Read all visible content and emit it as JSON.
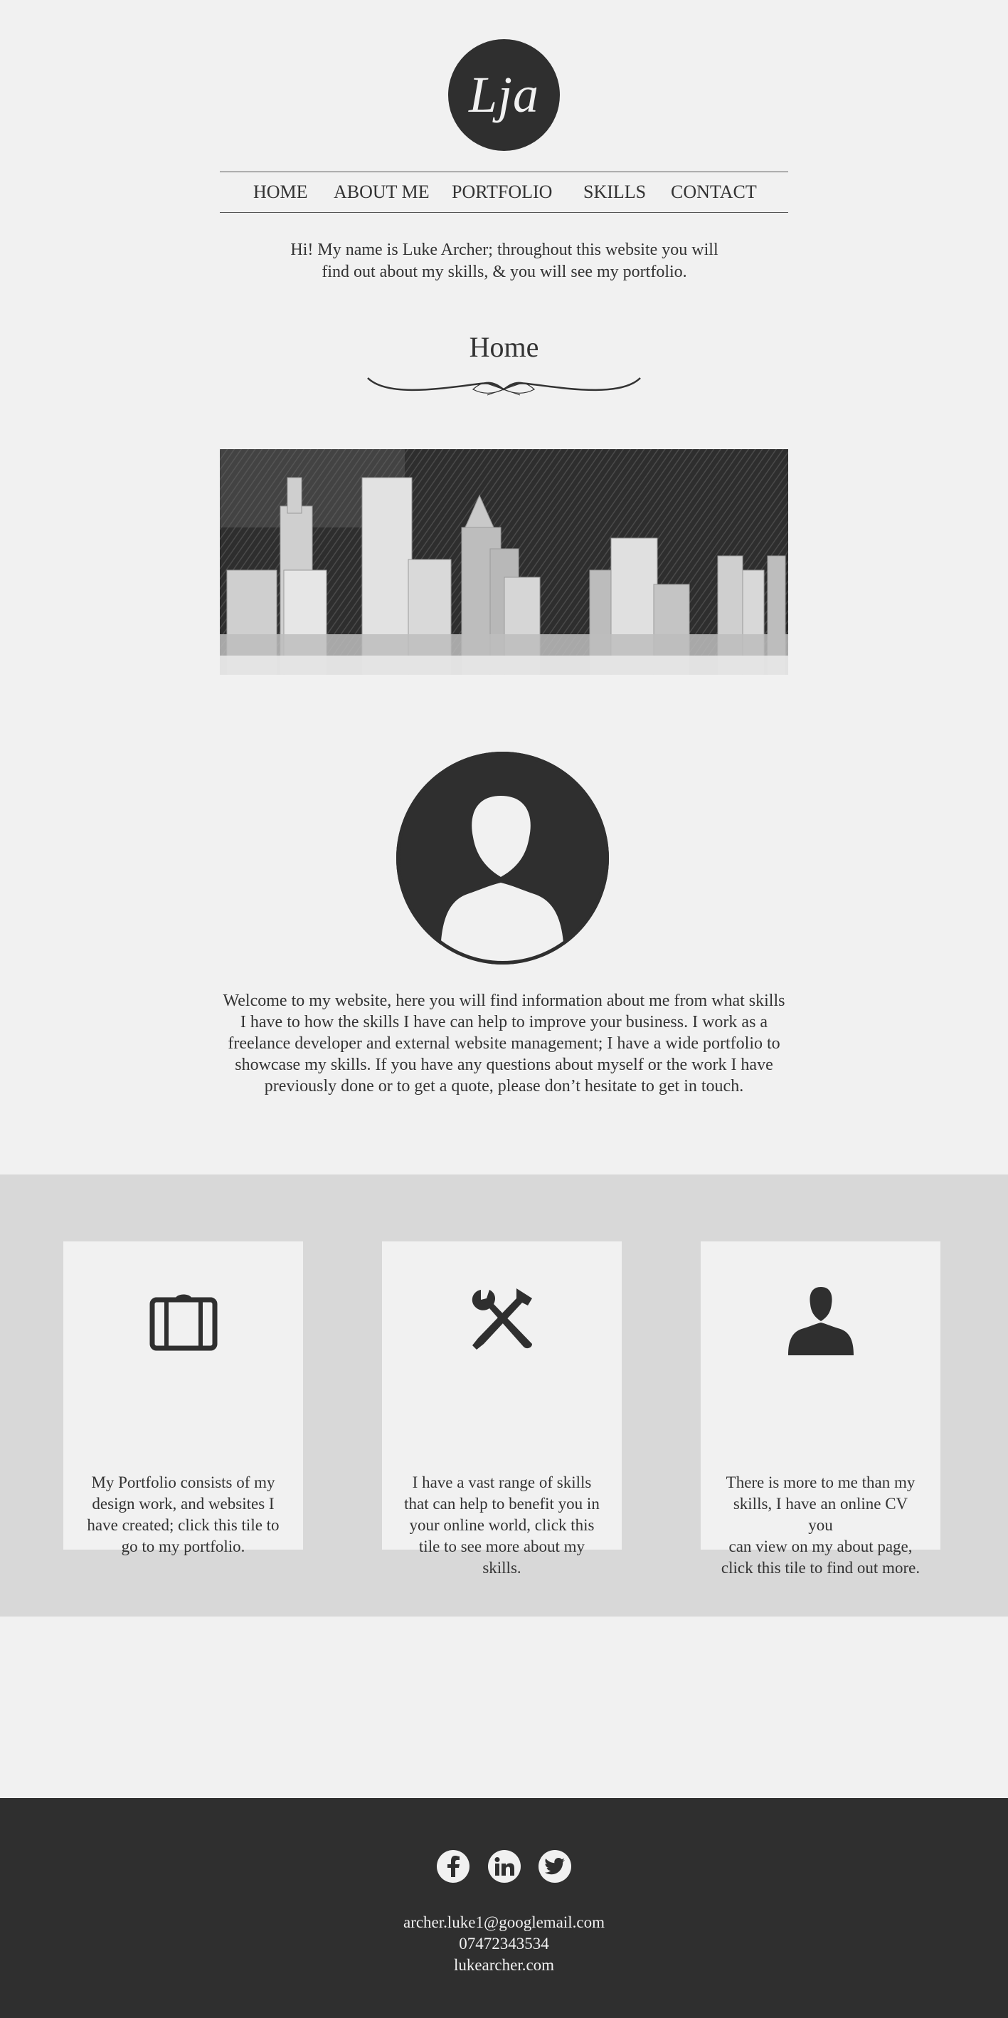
{
  "logo": {
    "text": "Lja"
  },
  "nav": {
    "items": [
      "HOME",
      "ABOUT ME",
      "PORTFOLIO",
      "SKILLS",
      "CONTACT"
    ]
  },
  "intro": {
    "line1": "Hi! My name is Luke Archer; throughout this website you will",
    "line2": "find out about my skills, & you will see my portfolio."
  },
  "page_title": "Home",
  "welcome": {
    "lines": [
      "Welcome to my website, here you will find information about me from what skills",
      "I have to how the skills I have can help to improve your business. I work as a",
      "freelance developer and external website management; I have a wide portfolio to",
      "showcase my skills. If you have any questions about myself or the work I have",
      "previously done or to get a quote, please don’t hesitate to get in touch."
    ]
  },
  "tiles": [
    {
      "icon": "briefcase-icon",
      "lines": [
        "My Portfolio consists of my",
        "design work, and websites I",
        "have created; click this tile to",
        "go to my portfolio."
      ]
    },
    {
      "icon": "tools-icon",
      "lines": [
        "I have a vast range of skills",
        "that can help to benefit you in",
        "your online world, click this",
        "tile to see more about my",
        "skills."
      ]
    },
    {
      "icon": "person-icon",
      "lines": [
        "There is more to me than my",
        "skills, I have an online CV you",
        "can view on my about page,",
        "click this tile to find out more."
      ]
    }
  ],
  "footer": {
    "social": [
      "facebook-icon",
      "linkedin-icon",
      "twitter-icon"
    ],
    "email": "archer.luke1@googlemail.com",
    "phone": "07472343534",
    "website": "lukearcher.com"
  },
  "colors": {
    "background": "#f1f1f1",
    "dark": "#2f2f2f",
    "band": "#d8d8d8"
  }
}
